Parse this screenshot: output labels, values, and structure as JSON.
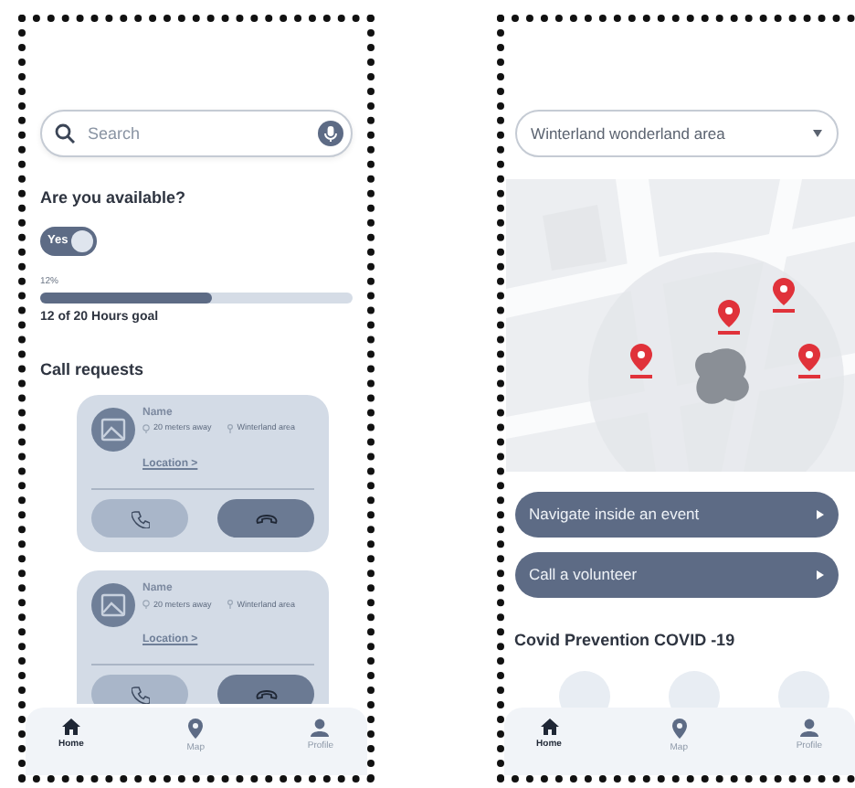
{
  "home": {
    "search": {
      "placeholder": "Search"
    },
    "availability": {
      "label": "Are you available?",
      "toggle_label": "Yes",
      "on": true
    },
    "progress": {
      "percent": "12%",
      "level": 0.55,
      "goal": "12 of 20 Hours goal"
    },
    "call_requests": {
      "title": "Call requests",
      "cards": [
        {
          "name": "Name",
          "distance": "20 meters away",
          "area": "Winterland area",
          "location": "Location >"
        },
        {
          "name": "Name",
          "distance": "20 meters away",
          "area": "Winterland area",
          "location": "Location >"
        }
      ]
    },
    "nav": [
      {
        "label": "Home",
        "selected": true
      },
      {
        "label": "Map",
        "selected": false
      },
      {
        "label": "Profile",
        "selected": false
      }
    ]
  },
  "map_screen": {
    "dropdown": {
      "value": "Winterland wonderland area"
    },
    "actions": [
      {
        "label": "Navigate inside an event"
      },
      {
        "label": "Call a volunteer"
      }
    ],
    "section_title": "Covid Prevention COVID -19",
    "nav": [
      {
        "label": "Home",
        "selected": true
      },
      {
        "label": "Map",
        "selected": false
      },
      {
        "label": "Profile",
        "selected": false
      }
    ]
  }
}
